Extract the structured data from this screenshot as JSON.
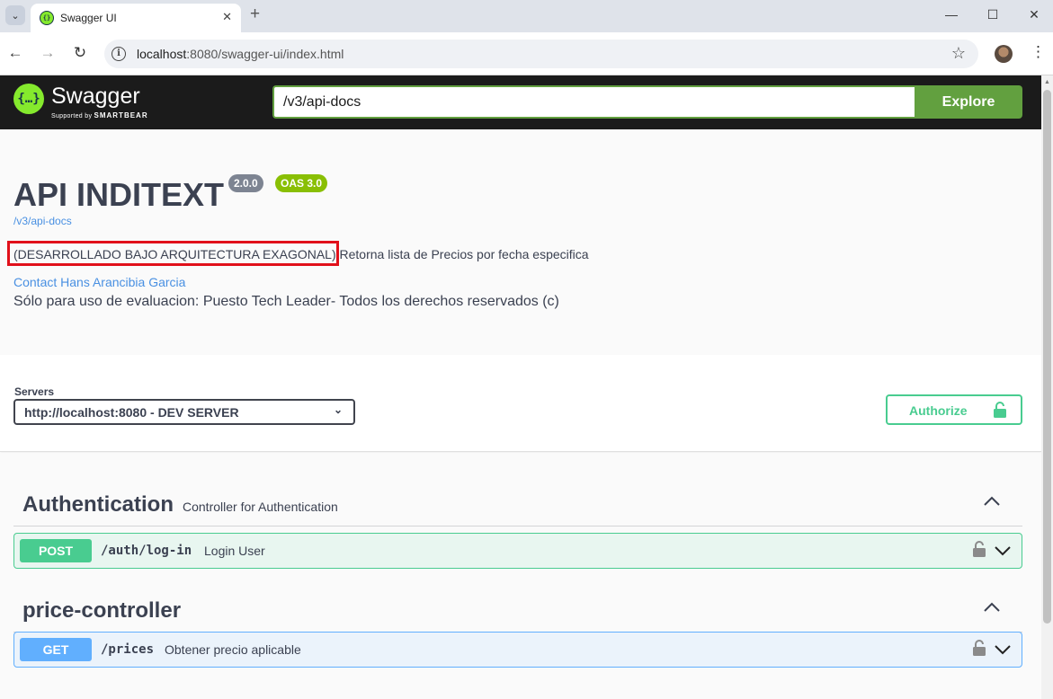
{
  "browser": {
    "tab_title": "Swagger UI",
    "new_tab": "+",
    "url_host": "localhost",
    "url_rest": ":8080/swagger-ui/index.html",
    "window_controls": [
      "—",
      "☐",
      "✕"
    ]
  },
  "topbar": {
    "brand": "Swagger",
    "supported_by": "Supported by",
    "smartbear": "SMARTBEAR",
    "spec_url": "/v3/api-docs",
    "explore_label": "Explore",
    "accent": "#85ea2d",
    "explore_color": "#62a03f"
  },
  "info": {
    "title": "API INDITEXT",
    "version": "2.0.0",
    "oas": "OAS 3.0",
    "spec_link": "/v3/api-docs",
    "description": "(DESARROLLADO BAJO ARQUITECTURA EXAGONAL) Retorna lista de Precios por fecha especifica",
    "contact": "Contact Hans Arancibia Garcia",
    "license": "Sólo para uso de evaluacion: Puesto Tech Leader- Todos los derechos reservados (c)"
  },
  "servers": {
    "label": "Servers",
    "selected": "http://localhost:8080 - DEV SERVER",
    "authorize_label": "Authorize"
  },
  "tags": [
    {
      "name": "Authentication",
      "description": "Controller for Authentication",
      "operations": [
        {
          "method": "POST",
          "path": "/auth/log-in",
          "summary": "Login User",
          "color": "#49cc90"
        }
      ]
    },
    {
      "name": "price-controller",
      "description": "",
      "operations": [
        {
          "method": "GET",
          "path": "/prices",
          "summary": "Obtener precio aplicable",
          "color": "#61affe"
        }
      ]
    }
  ]
}
